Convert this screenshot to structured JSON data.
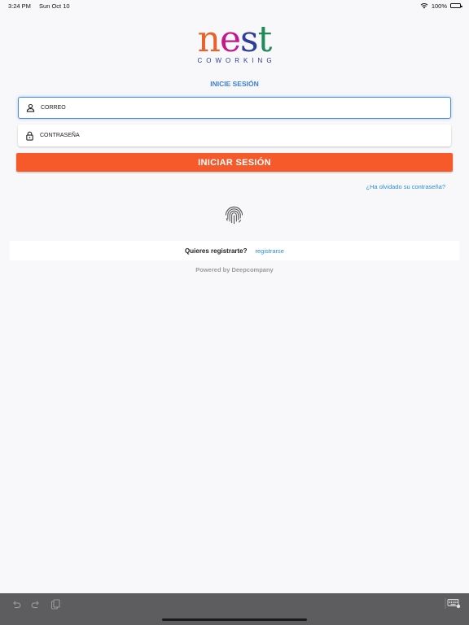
{
  "status_bar": {
    "time": "3:24 PM",
    "date": "Sun Oct 10",
    "battery": "100%",
    "battery_level": 1.0,
    "icons": [
      "wifi-icon",
      "battery-icon"
    ]
  },
  "logo": {
    "word_parts": [
      "n",
      "e",
      "s",
      "t"
    ],
    "subtitle": "COWORKING",
    "colors": [
      "#e8622a",
      "#c4178c",
      "#2c3d9c",
      "#1f8a5a"
    ]
  },
  "login": {
    "title": "INICIE SESIÓN",
    "email_placeholder": "CORREO",
    "password_placeholder": "CONTRASEÑA",
    "submit_label": "INICIAR SESIÓN",
    "forgot_label": "¿Ha olvidado su contraseña?",
    "icons": [
      "person-icon",
      "lock-icon",
      "fingerprint-icon"
    ]
  },
  "register": {
    "question": "Quieres registrarte?",
    "link_label": "registrarse"
  },
  "footer": {
    "powered_by": "Powered by Deepcompany"
  },
  "keyboard_bar": {
    "icons": [
      "undo-icon",
      "redo-icon",
      "paste-icon",
      "keyboard-icon"
    ]
  },
  "colors": {
    "accent": "#f75a2a",
    "link": "#2a8fd6",
    "title": "#3d7dd8",
    "focus_border": "#4a8ed9"
  }
}
